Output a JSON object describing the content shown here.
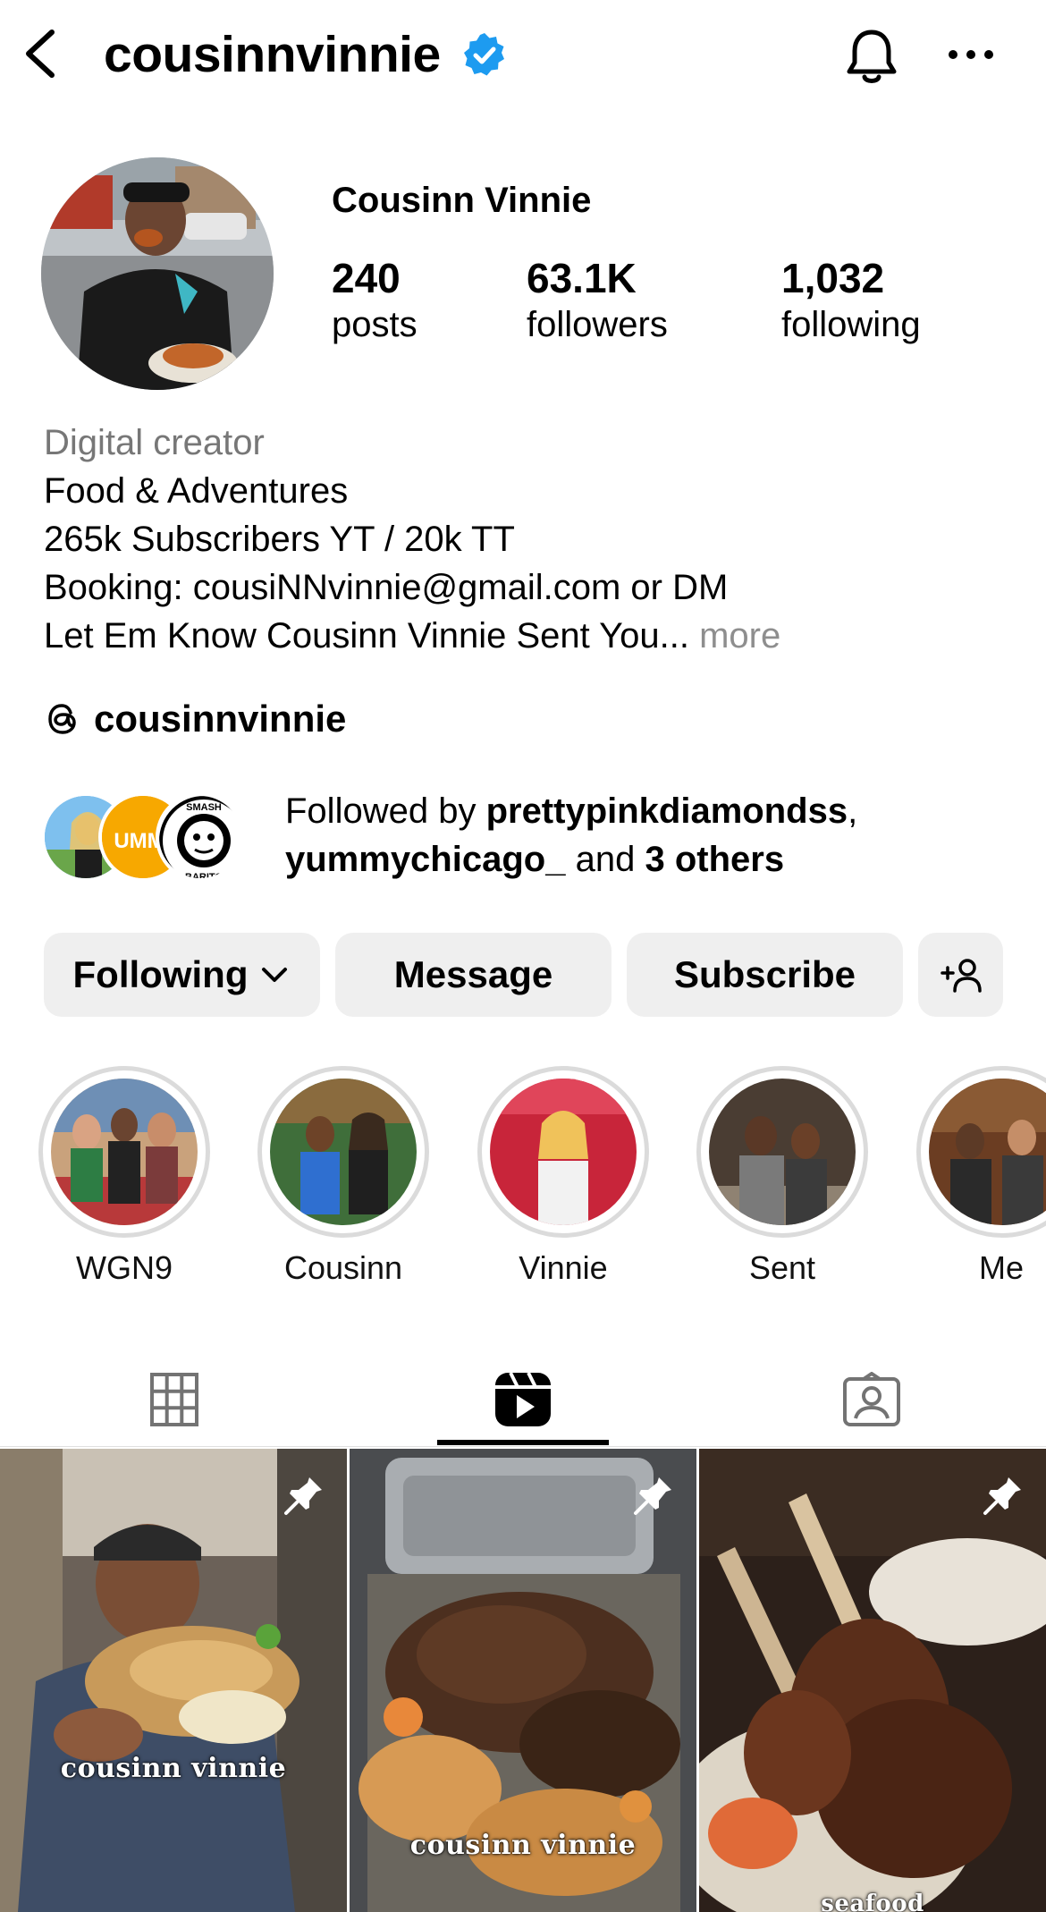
{
  "header": {
    "username": "cousinnvinnie",
    "verified": true,
    "icons": {
      "back": "chevron-left-icon",
      "verified": "verified-badge-icon",
      "notifications": "bell-icon",
      "more": "more-horizontal-icon"
    }
  },
  "profile": {
    "display_name": "Cousinn Vinnie",
    "stats": [
      {
        "value": "240",
        "label": "posts"
      },
      {
        "value": "63.1K",
        "label": "followers"
      },
      {
        "value": "1,032",
        "label": "following"
      }
    ]
  },
  "bio": {
    "category": "Digital creator",
    "lines": [
      "Food & Adventures",
      "265k Subscribers YT / 20k TT",
      "Booking: cousiNNvinnie@gmail.com or DM",
      "Let Em Know Cousinn Vinnie Sent You..."
    ],
    "more_label": "more"
  },
  "threads": {
    "handle": "cousinnvinnie",
    "icon": "threads-icon"
  },
  "followed_by": {
    "prefix": "Followed by",
    "user1": "prettypinkdiamondss",
    "separator": ",",
    "user2": "yummychicago_",
    "conjunction": "and",
    "others": "3 others",
    "avatar_texts": {
      "yummy": "UMMY",
      "smash_top": "SMASH",
      "smash_bottom": "BARITO"
    }
  },
  "actions": {
    "following_label": "Following",
    "message_label": "Message",
    "subscribe_label": "Subscribe",
    "add_user_icon": "add-person-icon"
  },
  "highlights": [
    {
      "label": "WGN9"
    },
    {
      "label": "Cousinn"
    },
    {
      "label": "Vinnie"
    },
    {
      "label": "Sent"
    },
    {
      "label": "Me"
    }
  ],
  "tabs": [
    {
      "icon": "grid-icon",
      "active": false
    },
    {
      "icon": "reels-icon",
      "active": true
    },
    {
      "icon": "tagged-icon",
      "active": false
    }
  ],
  "reels": [
    {
      "caption": "cousinn vinnie",
      "pinned": true
    },
    {
      "caption": "cousinn vinnie",
      "pinned": true
    },
    {
      "caption": "seafood",
      "pinned": true
    }
  ],
  "colors": {
    "verified": "#1d9bf0",
    "button_bg": "#efefef",
    "muted_text": "#777777",
    "ring": "#dbdbdb"
  }
}
